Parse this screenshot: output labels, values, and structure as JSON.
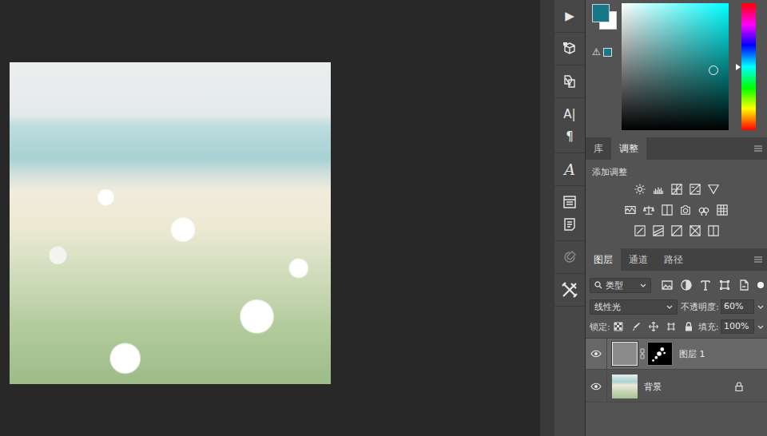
{
  "toolbar": {
    "groups": [
      [
        {
          "kind": "glyph",
          "text": "▶",
          "disabled": false
        }
      ],
      [
        {
          "kind": "icon",
          "disabled": false
        }
      ],
      [
        {
          "kind": "icon",
          "disabled": false
        }
      ],
      [
        {
          "kind": "glyph",
          "text": "A|",
          "disabled": false
        },
        {
          "kind": "glyph",
          "text": "¶",
          "disabled": false
        }
      ],
      [
        {
          "kind": "script",
          "text": "A",
          "disabled": false
        }
      ],
      [
        {
          "kind": "icon",
          "disabled": false
        },
        {
          "kind": "icon",
          "disabled": false
        }
      ],
      [
        {
          "kind": "icon",
          "disabled": true
        }
      ],
      [
        {
          "kind": "icon",
          "disabled": false
        }
      ]
    ]
  },
  "color_picker": {
    "foreground": "#17788a",
    "background": "#ffffff",
    "warning_glyph": "⚠",
    "hue_level": 0.5,
    "saturation": 0.86,
    "brightness": 0.47
  },
  "adjustments_panel": {
    "tabs": [
      {
        "label": "库",
        "selected": false
      },
      {
        "label": "调整",
        "selected": true
      }
    ],
    "heading": "添加调整"
  },
  "layers_panel": {
    "tabs": [
      {
        "label": "图层",
        "selected": true
      },
      {
        "label": "通道",
        "selected": false
      },
      {
        "label": "路径",
        "selected": false
      }
    ],
    "filter": "类型",
    "blend_mode": "线性光",
    "opacity_label": "不透明度:",
    "opacity": "60%",
    "lock_label": "锁定:",
    "fill_label": "填充:",
    "fill": "100%",
    "layers": [
      {
        "name": "图层 1",
        "visible": true,
        "selected": true,
        "locked": false,
        "kind": "masked"
      },
      {
        "name": "背景",
        "visible": true,
        "selected": false,
        "locked": true,
        "kind": "background"
      }
    ]
  }
}
